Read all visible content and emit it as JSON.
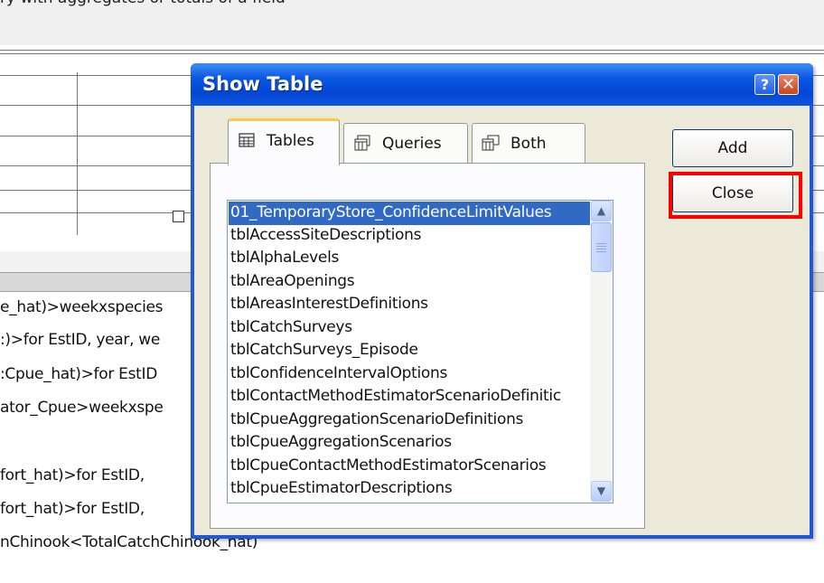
{
  "background": {
    "partial_title": "ry with aggregates or totals of a field",
    "expressions": [
      "e_hat)>weekxspecies",
      ":)>for EstID, year, we",
      ":Cpue_hat)>for EstID",
      "ator_Cpue>weekxspe",
      "",
      "fort_hat)>for EstID,",
      "fort_hat)>for EstID,",
      "nChinook<TotalCatchChinook_hat)"
    ]
  },
  "dialog": {
    "title": "Show Table",
    "help_glyph": "?",
    "close_glyph": "✕",
    "tabs": [
      {
        "label": "Tables",
        "icon": "table-icon",
        "active": true
      },
      {
        "label": "Queries",
        "icon": "query-icon",
        "active": false
      },
      {
        "label": "Both",
        "icon": "both-icon",
        "active": false
      }
    ],
    "list": {
      "selected_index": 0,
      "items": [
        "01_TemporaryStore_ConfidenceLimitValues",
        "tblAccessSiteDescriptions",
        "tblAlphaLevels",
        "tblAreaOpenings",
        "tblAreasInterestDefinitions",
        "tblCatchSurveys",
        "tblCatchSurveys_Episode",
        "tblConfidenceIntervalOptions",
        "tblContactMethodEstimatorScenarioDefinitic",
        "tblCpueAggregationScenarioDefinitions",
        "tblCpueAggregationScenarios",
        "tblCpueContactMethodEstimatorScenarios",
        "tblCpueEstimatorDescriptions"
      ],
      "scroll_up_glyph": "▲",
      "scroll_down_glyph": "▼"
    },
    "buttons": {
      "add": "Add",
      "close": "Close"
    }
  },
  "colors": {
    "selection": "#316ac5",
    "highlight": "#ff0000",
    "titlebar": "#0346d4"
  }
}
